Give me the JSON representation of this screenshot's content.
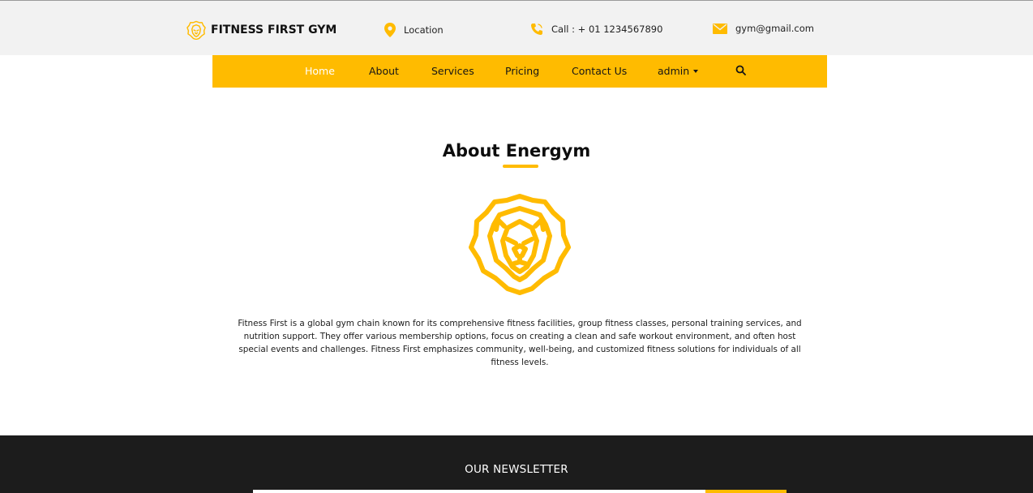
{
  "header": {
    "brand_name": "FITNESS FIRST GYM",
    "brand_logo_icon": "lion-head-icon",
    "location_icon": "map-pin-icon",
    "location_label": "Location",
    "phone_icon": "phone-icon",
    "call_label": "Call : + 01 1234567890",
    "email_icon": "envelope-icon",
    "email": "gym@gmail.com"
  },
  "nav": {
    "items": [
      "Home",
      "About",
      "Services",
      "Pricing",
      "Contact Us"
    ],
    "active": "Home",
    "user_label": "admin",
    "search_icon": "search-icon"
  },
  "about": {
    "title": "About Energym",
    "image_icon": "lion-head-icon",
    "text": "Fitness First is a global gym chain known for its comprehensive fitness facilities, group fitness classes, personal training services, and nutrition support. They offer various membership options, focus on creating a clean and safe workout environment, and often host special events and challenges. Fitness First emphasizes community, well-being, and customized fitness solutions for individuals of all fitness levels."
  },
  "footer": {
    "newsletter_title": "OUR NEWSLETTER"
  },
  "colors": {
    "accent": "#ffbb00",
    "topbar_bg": "#f2f2f2",
    "footer_bg": "#1c1c1c",
    "text_dark": "#111111"
  }
}
